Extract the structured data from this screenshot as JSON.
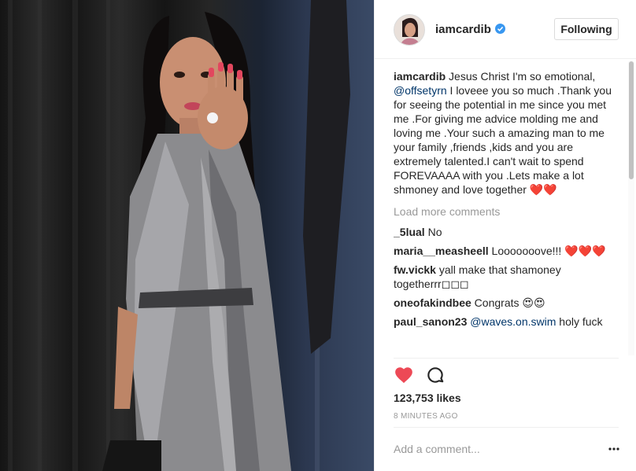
{
  "photo": {
    "alt": ""
  },
  "header": {
    "username": "iamcardib",
    "follow_label": "Following",
    "icons": {
      "verified": "verified-badge-icon"
    }
  },
  "caption": {
    "username": "iamcardib",
    "text_before_mention": " Jesus Christ I'm so emotional,",
    "mention": "@offsetyrn",
    "text_after_mention": " I loveee you so much .Thank you for seeing the potential in me since you met me .For giving me advice molding me and loving me .Your such a amazing man to me your family ,friends ,kids and you are extremely talented.I can't wait to spend FOREVAAAA with you .Lets make a lot shmoney and love together ❤️❤️"
  },
  "load_more": "Load more comments",
  "comments": [
    {
      "username": "_5lual",
      "text": " No",
      "mention": "",
      "rest": ""
    },
    {
      "username": "maria__measheell",
      "text": " Looooooove!!! ❤️❤️❤️",
      "mention": "",
      "rest": ""
    },
    {
      "username": "fw.vickk",
      "text": " yall make that shamoney togetherrr◻◻◻",
      "mention": "",
      "rest": ""
    },
    {
      "username": "oneofakindbee",
      "text": " Congrats 😍😍",
      "mention": "",
      "rest": ""
    },
    {
      "username": "paul_sanon23",
      "text": " ",
      "mention": "@waves.on.swim",
      "rest": " holy fuck"
    }
  ],
  "actions": {
    "like_icon": "heart-filled-icon",
    "comment_icon": "comment-bubble-icon",
    "like_color": "#ed4956"
  },
  "likes": "123,753 likes",
  "timestamp": "8 MINUTES AGO",
  "add_comment": {
    "placeholder": "Add a comment..."
  },
  "more_icon": "more-options-icon",
  "colors": {
    "mention": "#003569",
    "muted": "#999999",
    "border": "#efefef"
  }
}
